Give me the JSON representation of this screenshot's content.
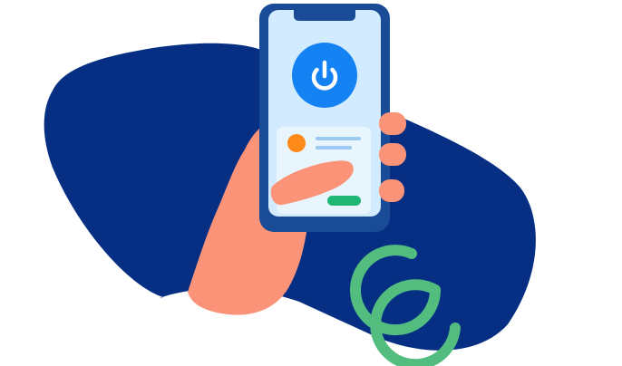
{
  "colors": {
    "background": "#ffffff",
    "blob": "#062f84",
    "phone_frame": "#1a4b97",
    "screen": "#d3ebff",
    "power_button": "#1582f4",
    "card": "#e8f5fc",
    "avatar_dot": "#ff8a1a",
    "text_lines": "#9ccaf3",
    "confirm_pill": "#1fb573",
    "hand": "#fa9377",
    "loop": "#52bd7f"
  },
  "icons": {
    "power": "power-icon",
    "loop": "infinity-loop-icon"
  }
}
